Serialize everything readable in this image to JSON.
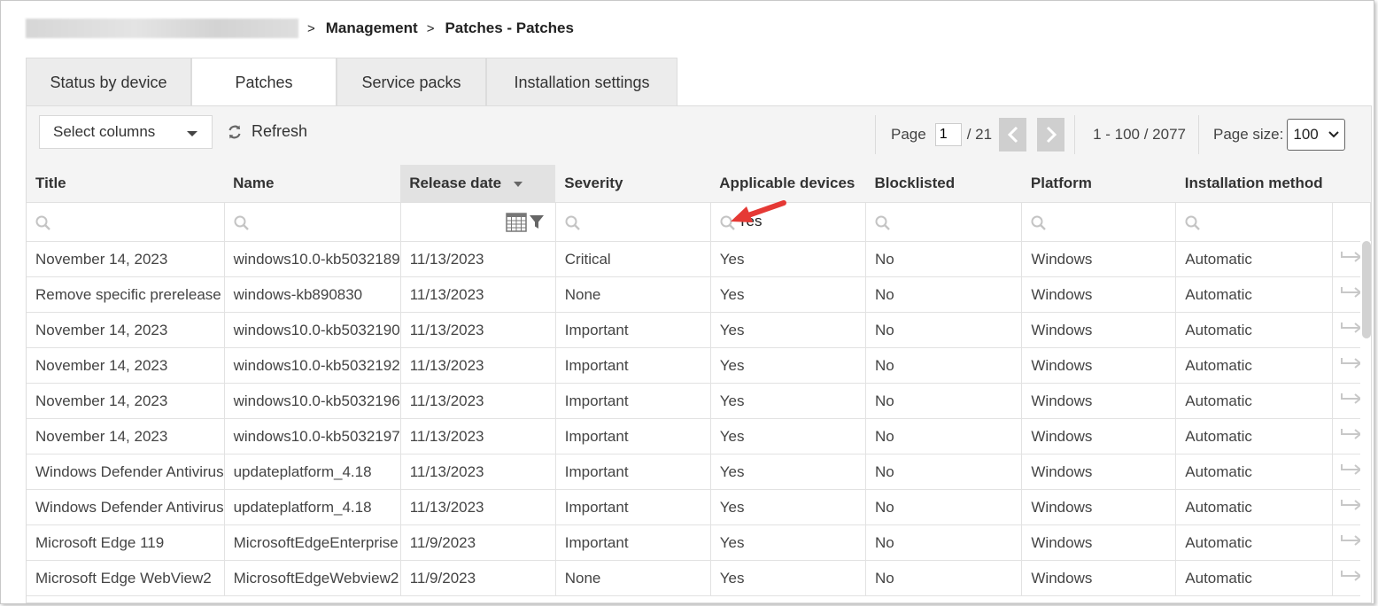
{
  "breadcrumb": {
    "items": [
      "Management",
      "Patches - Patches"
    ],
    "separator": ">"
  },
  "tabs": [
    {
      "label": "Status by device",
      "active": false
    },
    {
      "label": "Patches",
      "active": true
    },
    {
      "label": "Service packs",
      "active": false
    },
    {
      "label": "Installation settings",
      "active": false
    }
  ],
  "toolbar": {
    "select_columns": "Select columns",
    "refresh": "Refresh"
  },
  "pager": {
    "page_label": "Page",
    "current_page": "1",
    "total_pages": "/ 21",
    "range": "1 - 100 / 2077",
    "page_size_label": "Page size:",
    "page_size": "100"
  },
  "table": {
    "columns": [
      "Title",
      "Name",
      "Release date",
      "Severity",
      "Applicable devices",
      "Blocklisted",
      "Platform",
      "Installation method"
    ],
    "sorted_column": "Release date",
    "filters": {
      "applicable_devices": "Yes"
    },
    "rows": [
      [
        "November 14, 2023",
        "windows10.0-kb5032189",
        "11/13/2023",
        "Critical",
        "Yes",
        "No",
        "Windows",
        "Automatic"
      ],
      [
        "Remove specific prerelease",
        "windows-kb890830",
        "11/13/2023",
        "None",
        "Yes",
        "No",
        "Windows",
        "Automatic"
      ],
      [
        "November 14, 2023",
        "windows10.0-kb5032190",
        "11/13/2023",
        "Important",
        "Yes",
        "No",
        "Windows",
        "Automatic"
      ],
      [
        "November 14, 2023",
        "windows10.0-kb5032192",
        "11/13/2023",
        "Important",
        "Yes",
        "No",
        "Windows",
        "Automatic"
      ],
      [
        "November 14, 2023",
        "windows10.0-kb5032196",
        "11/13/2023",
        "Important",
        "Yes",
        "No",
        "Windows",
        "Automatic"
      ],
      [
        "November 14, 2023",
        "windows10.0-kb5032197",
        "11/13/2023",
        "Important",
        "Yes",
        "No",
        "Windows",
        "Automatic"
      ],
      [
        "Windows Defender Antivirus",
        "updateplatform_4.18",
        "11/13/2023",
        "Important",
        "Yes",
        "No",
        "Windows",
        "Automatic"
      ],
      [
        "Windows Defender Antivirus",
        "updateplatform_4.18",
        "11/13/2023",
        "Important",
        "Yes",
        "No",
        "Windows",
        "Automatic"
      ],
      [
        "Microsoft Edge 119",
        "MicrosoftEdgeEnterprise",
        "11/9/2023",
        "Important",
        "Yes",
        "No",
        "Windows",
        "Automatic"
      ],
      [
        "Microsoft Edge WebView2",
        "MicrosoftEdgeWebview2",
        "11/9/2023",
        "None",
        "Yes",
        "No",
        "Windows",
        "Automatic"
      ]
    ]
  },
  "colors": {
    "header_bg": "#f4f4f4",
    "sorted_header_bg": "#e2e2e2",
    "annotation_arrow": "#e53935"
  }
}
